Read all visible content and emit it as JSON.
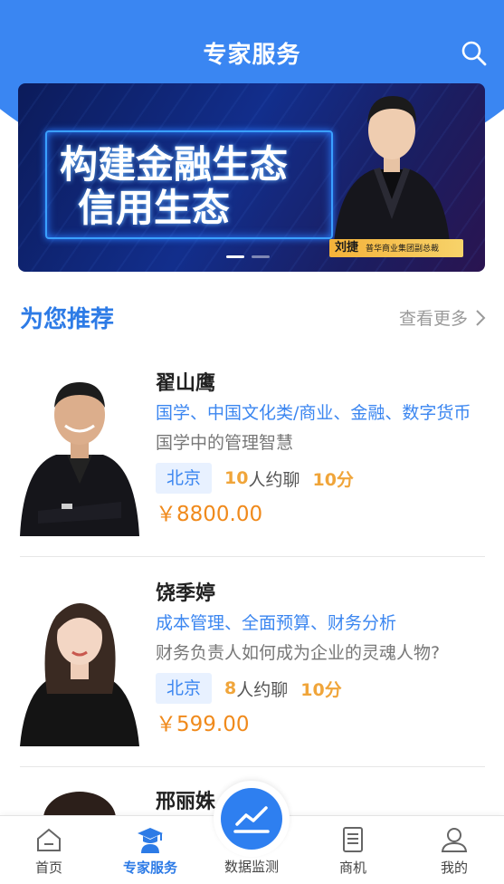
{
  "header": {
    "title": "专家服务",
    "search_icon": "search-icon"
  },
  "banner": {
    "headline_line1": "构建金融生态",
    "headline_line2": "信用生态",
    "speaker_name": "刘捷",
    "speaker_title": "普华商业集团副总裁",
    "slides": 2,
    "active_slide": 1
  },
  "section": {
    "title": "为您推荐",
    "more_label": "查看更多"
  },
  "experts": [
    {
      "name": "翟山鹰",
      "fields": "国学、中国文化类/商业、金融、数字货币",
      "desc": "国学中的管理智慧",
      "city": "北京",
      "count": "10",
      "count_label": "人约聊",
      "score": "10分",
      "price": "￥8800.00"
    },
    {
      "name": "饶季婷",
      "fields": "成本管理、全面预算、财务分析",
      "desc": "财务负责人如何成为企业的灵魂人物?",
      "city": "北京",
      "count": "8",
      "count_label": "人约聊",
      "score": "10分",
      "price": "￥599.00"
    },
    {
      "name": "邢丽姝"
    }
  ],
  "nav": {
    "home": "首页",
    "expert": "专家服务",
    "monitor": "数据监测",
    "business": "商机",
    "mine": "我的"
  },
  "colors": {
    "primary": "#2d7be6",
    "accent": "#f0a53a",
    "price": "#f08a1c"
  }
}
